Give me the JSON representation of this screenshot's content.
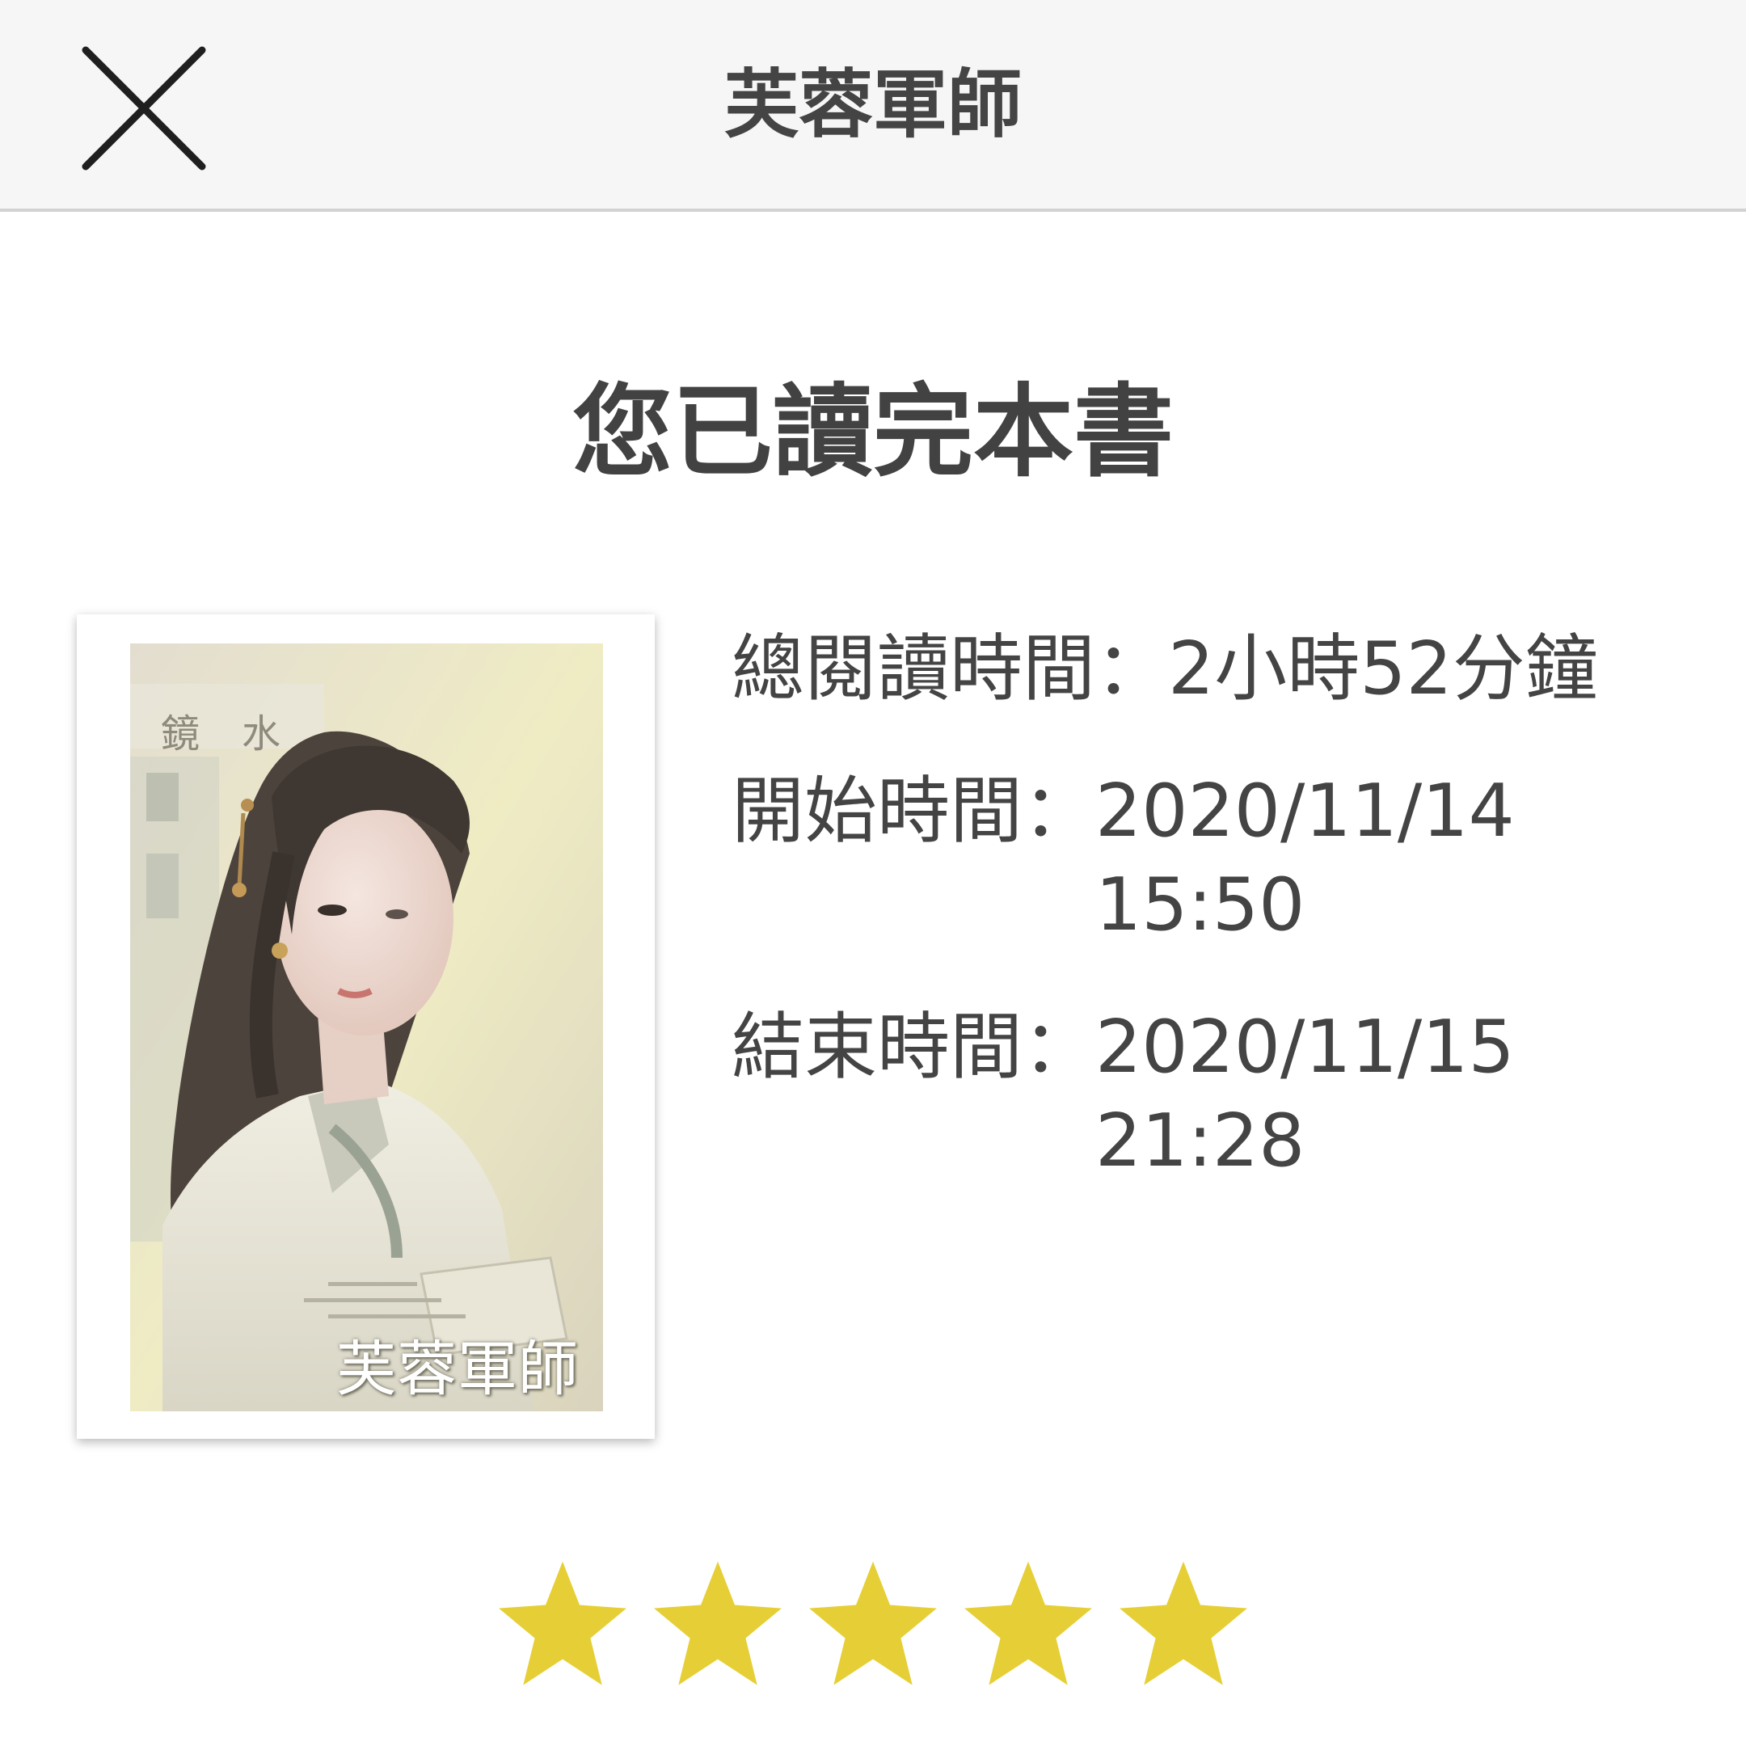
{
  "header": {
    "title": "芙蓉軍師",
    "close_icon": "close-icon"
  },
  "main": {
    "heading": "您已讀完本書",
    "cover": {
      "author_text": "鏡　水",
      "title_text": "芙蓉軍師"
    },
    "stats": {
      "total_label": "總閱讀時間：",
      "total_value": "2小時52分鐘",
      "start_label": "開始時間：",
      "start_date": "2020/11/14",
      "start_time": "15:50",
      "end_label": "結束時間：",
      "end_date": "2020/11/15",
      "end_time": "21:28"
    },
    "rating": {
      "value": 5,
      "max": 5,
      "star_color": "#e6cf36"
    }
  }
}
